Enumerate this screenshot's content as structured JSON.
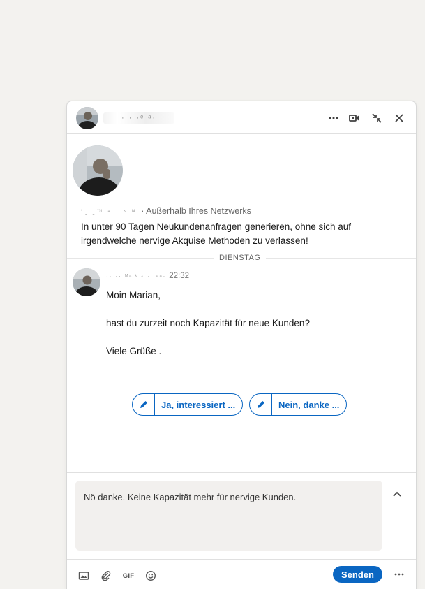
{
  "header": {
    "name_redacted": "· · ·ᵉ ᵃ·",
    "more_icon": "ellipsis-icon",
    "video_icon": "video-call-icon",
    "minimize_icon": "compress-icon",
    "close_icon": "close-icon"
  },
  "profile": {
    "name_redacted": "ʻ ̱ʼ ̱ ̃ᵈ ᵃ · ˢ ᴺ",
    "network_status": "· Außerhalb Ihres Netzwerks",
    "headline": "In unter 90 Tagen Neukundenanfragen generieren, ohne sich auf irgendwelche nervige Akquise Methoden zu verlassen!"
  },
  "divider": {
    "day": "DIENSTAG"
  },
  "message": {
    "sender_redacted": "·· ·· ᴹᵃᶦᵏ ᶻ ·ᶦ ᵍᵃ·",
    "time": "22:32",
    "lines": [
      "Moin Marian,",
      "hast du zurzeit noch Kapazität für neue Kunden?",
      "Viele Grüße ."
    ]
  },
  "quick_replies": [
    "Ja, interessiert ...",
    "Nein, danke ..."
  ],
  "compose": {
    "text": "Nö danke. Keine Kapazität mehr für nervige Kunden.",
    "expand_icon": "chevron-up-icon"
  },
  "toolbar": {
    "image_icon": "image-icon",
    "attach_icon": "paperclip-icon",
    "gif_label": "GIF",
    "emoji_icon": "emoji-icon",
    "send_label": "Senden",
    "more_icon": "ellipsis-icon"
  },
  "colors": {
    "accent": "#0a66c2",
    "page_bg": "#f3f2ef",
    "compose_bg": "#f2f0ee"
  }
}
